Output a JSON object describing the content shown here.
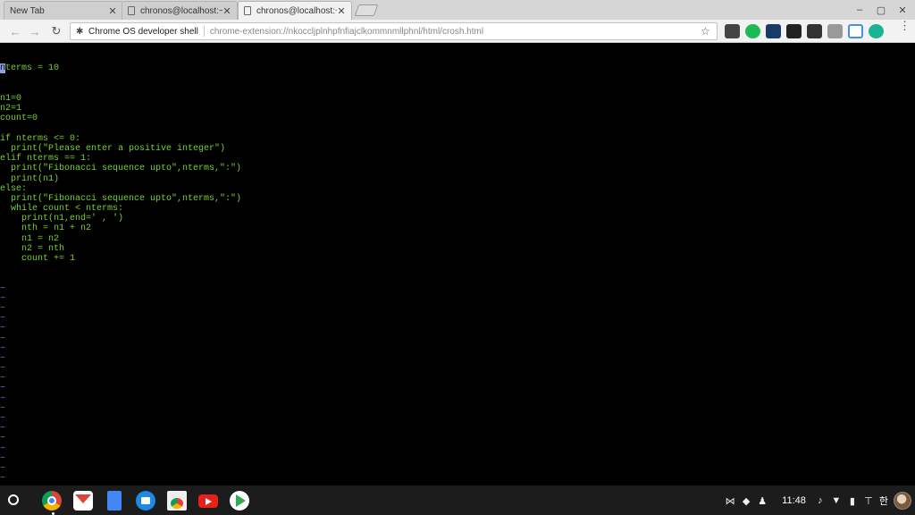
{
  "tabs": [
    {
      "label": "New Tab",
      "active": false
    },
    {
      "label": "chronos@localhost:~/",
      "active": false
    },
    {
      "label": "chronos@localhost:~/",
      "active": true
    }
  ],
  "toolbar": {
    "back_icon": "←",
    "forward_icon": "→",
    "reload_icon": "↻",
    "omnibox_title": "Chrome OS developer shell",
    "omnibox_url": "chrome-extension://nkoccljplnhpfnfiajclkommnmllphnl/html/crosh.html",
    "star_icon": "☆",
    "menu_icon": "⋮"
  },
  "window_controls": {
    "minimize": "–",
    "maximize": "▢",
    "close": "✕"
  },
  "terminal": {
    "cursor_char": "n",
    "lines": [
      "terms = 10",
      "n1=0",
      "n2=1",
      "count=0",
      "",
      "if nterms <= 0:",
      "  print(\"Please enter a positive integer\")",
      "elif nterms == 1:",
      "  print(\"Fibonacci sequence upto\",nterms,\":\")",
      "  print(n1)",
      "else:",
      "  print(\"Fibonacci sequence upto\",nterms,\":\")",
      "  while count < nterms:",
      "    print(n1,end=' , ')",
      "    nth = n1 + n2",
      "    n1 = n2",
      "    n2 = nth",
      "    count += 1"
    ],
    "tilde": "~",
    "tilde_count": 25
  },
  "shelf": {
    "apps": [
      "chrome-icon",
      "gmail-icon",
      "docs-icon",
      "files-icon",
      "webstore-icon",
      "youtube-icon",
      "play-store-icon"
    ],
    "tray_icons": [
      "share-icon",
      "android-icon",
      "person-icon"
    ],
    "clock": "11:48",
    "status_icons": [
      "mute",
      "wifi",
      "battery",
      "keyboard"
    ],
    "ime": "한"
  },
  "colors": {
    "terminal_text": "#78d22a",
    "tilde": "#5b77c4",
    "extensions": [
      "#444444",
      "#1db954",
      "#1a3a6a",
      "#222222",
      "#333333",
      "#999999",
      "#4a90e2",
      "#1ab394"
    ]
  }
}
